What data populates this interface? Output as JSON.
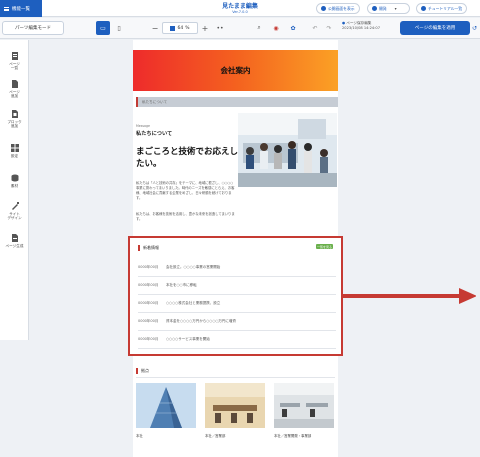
{
  "topbar": {
    "back_label": "機能一覧",
    "title": "見たまま編集",
    "subtitle": "Ver.7.0.0",
    "public_label": "公開画面を表示",
    "help_label": "開発",
    "tutorial_label": "チュートリアル一覧"
  },
  "toolbar": {
    "mode_label": "パーツ編集モード",
    "zoom_value": "64",
    "zoom_unit": "%",
    "saved_line1": "ページ保存編集",
    "saved_line2": "2023/10/08 14:24:07",
    "apply_label": "ページの編集を適用"
  },
  "sidebar": {
    "items": [
      {
        "label": "ページ\n一覧",
        "icon": "pages-icon"
      },
      {
        "label": "ページ\n追加",
        "icon": "page-add-icon"
      },
      {
        "label": "ブロック\n追加",
        "icon": "block-add-icon"
      },
      {
        "label": "設定",
        "icon": "grid-settings-icon"
      },
      {
        "label": "素材",
        "icon": "assets-icon"
      },
      {
        "label": "サイト\nデザイン",
        "icon": "site-design-icon"
      },
      {
        "label": "ページ生成",
        "icon": "page-generate-icon"
      }
    ]
  },
  "preview": {
    "hero_title": "会社案内",
    "section1_label": "私たちについて",
    "message_small": "Message",
    "message_heading": "私たちについて",
    "message_title": "まごころと技術でお応えしたい。",
    "message_p1": "私たちは「人と技術の共存」をテーマに、地域に根ざし、○○○○事業に携わってまいりました。時代のニーズを敏感にとらえ、お客様、地域社会に貢献する企業をめざし、日々研鑽を続けております。",
    "message_p2": "私たちは、お客様を技術を活用し、豊かな未来を創造してまいります。",
    "news": {
      "title": "新着情報",
      "list_button": "一覧を見る",
      "rows": [
        {
          "date": "0000年00月",
          "text": "会社設立。○○○○事業の営業開始"
        },
        {
          "date": "0000年00月",
          "text": "本社を○○市に移転"
        },
        {
          "date": "0000年00月",
          "text": "○○○○株式会社と業務提携、設立"
        },
        {
          "date": "0000年00月",
          "text": "資本金を○○○○万円から○○○○万円に増資"
        },
        {
          "date": "0000年00月",
          "text": "○○○○サービス事業を開始"
        }
      ]
    },
    "store": {
      "title": "拠点",
      "captions": [
        "本社",
        "本社／営業部",
        "本社／営業開発・事業部"
      ]
    }
  },
  "colors": {
    "brand_blue": "#1e5fbf",
    "highlight_red": "#c63a33",
    "hero_gradient_start": "#ee2b2b",
    "hero_gradient_end": "#fba125",
    "list_button_green": "#6ab04c"
  }
}
